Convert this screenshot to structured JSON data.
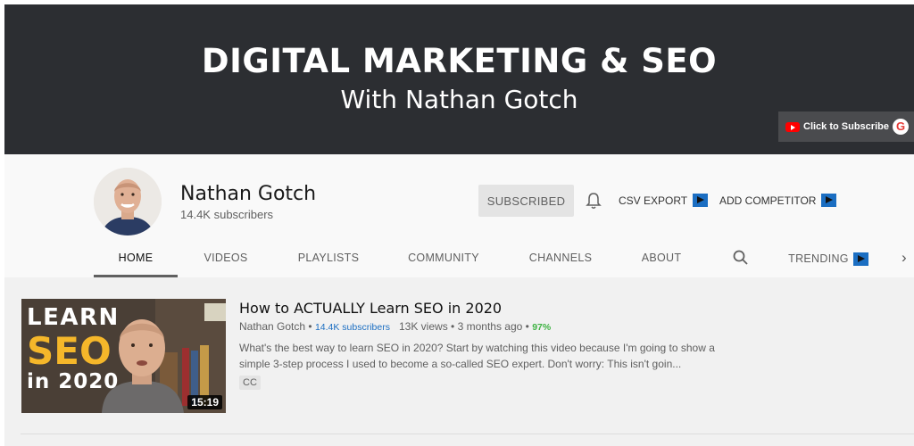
{
  "banner": {
    "title": "DIGITAL MARKETING & SEO",
    "subtitle": "With Nathan Gotch",
    "subscribe_link": "Click to Subscribe",
    "brand_letter": "G"
  },
  "channel": {
    "name": "Nathan Gotch",
    "subscribers": "14.4K subscribers",
    "subscribed_label": "SUBSCRIBED",
    "csv_export_label": "CSV EXPORT",
    "add_competitor_label": "ADD COMPETITOR"
  },
  "tabs": [
    {
      "label": "HOME",
      "active": true
    },
    {
      "label": "VIDEOS"
    },
    {
      "label": "PLAYLISTS"
    },
    {
      "label": "COMMUNITY"
    },
    {
      "label": "CHANNELS"
    },
    {
      "label": "ABOUT"
    },
    {
      "label": "TRENDING"
    }
  ],
  "video": {
    "title": "How to ACTUALLY Learn SEO in 2020",
    "channel": "Nathan Gotch",
    "separator": "•",
    "channel_subs": "14.4K subscribers",
    "views": "13K views",
    "age": "3 months ago",
    "score": "97%",
    "description": "What's the best way to learn SEO in 2020? Start by watching this video because I'm going to show a simple 3-step process I used to become a so-called SEO expert. Don't worry: This isn't goin...",
    "cc_badge": "CC",
    "duration": "15:19",
    "thumbnail": {
      "line1": "LEARN",
      "line2": "SEO",
      "line3": "in 2020"
    }
  },
  "colors": {
    "banner_bg": "#2c2e32",
    "accent_blue": "#1b6ec2",
    "score_green": "#3fb344",
    "youtube_red": "#ff0000"
  }
}
